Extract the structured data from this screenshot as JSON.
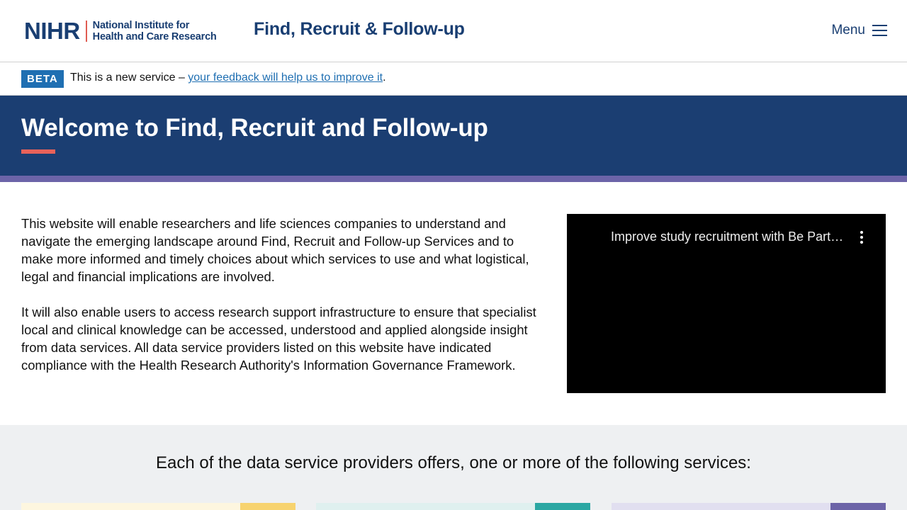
{
  "header": {
    "logo_acronym": "NIHR",
    "logo_line1": "National Institute for",
    "logo_line2": "Health and Care Research",
    "service_title": "Find, Recruit & Follow-up",
    "menu_label": "Menu"
  },
  "beta_banner": {
    "tag": "BETA",
    "text_before": "This is a new service – ",
    "link_text": "your feedback will help us to improve it",
    "text_after": "."
  },
  "hero": {
    "title": "Welcome to Find, Recruit and Follow-up"
  },
  "intro": {
    "paragraph1": "This website will enable researchers and life sciences companies to understand and navigate the emerging landscape around Find, Recruit and Follow-up Services and to make more informed and timely choices about which services to use and what logistical, legal and financial implications are involved.",
    "paragraph2": "It will also enable users to access research support infrastructure to ensure that specialist local and clinical knowledge can be accessed, understood and applied alongside insight from data services. All data service providers listed on this website have indicated compliance with the Health Research Authority's Information Governance Framework."
  },
  "video": {
    "title": "Improve study recruitment with Be Part of Research"
  },
  "services": {
    "heading": "Each of the data service providers offers, one or more of the following services:"
  },
  "colors": {
    "brand_navy": "#1b3e72",
    "accent_coral": "#e8625a",
    "stripe_purple": "#6c64a8",
    "link_blue": "#1f6fb2",
    "card_yellow": "#f7d36f",
    "card_teal": "#2ba7a3",
    "card_purple": "#6c64a8"
  }
}
